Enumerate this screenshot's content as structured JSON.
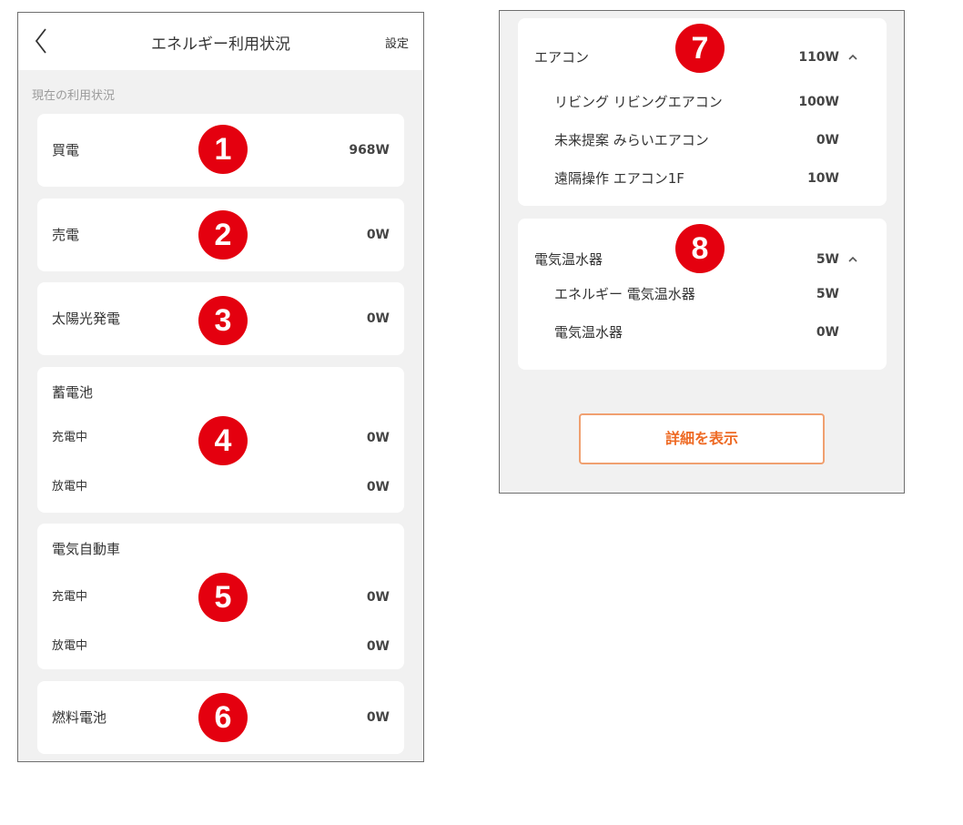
{
  "left_screen": {
    "header": {
      "title": "エネルギー利用状況",
      "settings": "設定"
    },
    "section_label": "現在の利用状況",
    "cards": [
      {
        "label": "買電",
        "value": "968W",
        "badge": "1"
      },
      {
        "label": "売電",
        "value": "0W",
        "badge": "2"
      },
      {
        "label": "太陽光発電",
        "value": "0W",
        "badge": "3"
      },
      {
        "label": "蓄電池",
        "badge": "4",
        "rows": [
          {
            "label": "充電中",
            "value": "0W"
          },
          {
            "label": "放電中",
            "value": "0W"
          }
        ]
      },
      {
        "label": "電気自動車",
        "badge": "5",
        "rows": [
          {
            "label": "充電中",
            "value": "0W"
          },
          {
            "label": "放電中",
            "value": "0W"
          }
        ]
      },
      {
        "label": "燃料電池",
        "value": "0W",
        "badge": "6"
      }
    ]
  },
  "right_screen": {
    "devices": [
      {
        "name": "エアコン",
        "value": "110W",
        "badge": "7",
        "items": [
          {
            "name": "リビング リビングエアコン",
            "value": "100W"
          },
          {
            "name": "未来提案 みらいエアコン",
            "value": "0W"
          },
          {
            "name": "遠隔操作 エアコン1F",
            "value": "10W"
          }
        ]
      },
      {
        "name": "電気温水器",
        "value": "5W",
        "badge": "8",
        "items": [
          {
            "name": "エネルギー 電気温水器",
            "value": "5W"
          },
          {
            "name": "電気温水器",
            "value": "0W"
          }
        ]
      }
    ],
    "detail_button": "詳細を表示"
  },
  "colors": {
    "badge": "#e4000f",
    "accent": "#ee6a24",
    "accent_border": "#f0a070",
    "background": "#f1f1f1",
    "card": "#ffffff"
  },
  "icons": {
    "back": "chevron-left-icon",
    "expand": "chevron-up-icon"
  }
}
